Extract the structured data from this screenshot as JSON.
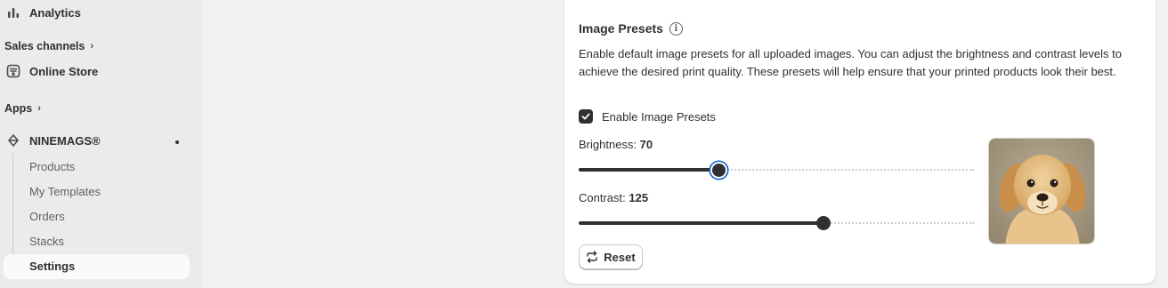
{
  "sidebar": {
    "analytics_label": "Analytics",
    "sales_channels_label": "Sales channels",
    "online_store_label": "Online Store",
    "apps_label": "Apps",
    "app_name": "NINEMAGS®",
    "sub_items": [
      "Products",
      "My Templates",
      "Orders",
      "Stacks",
      "Settings"
    ],
    "active_item": "Settings"
  },
  "presets": {
    "title": "Image Presets",
    "description": "Enable default image presets for all uploaded images. You can adjust the brightness and contrast levels to achieve the desired print quality. These presets will help ensure that your printed products look their best.",
    "checkbox_label": "Enable Image Presets",
    "checkbox_checked": true,
    "brightness_label": "Brightness:",
    "brightness_value": "70",
    "brightness_fraction": 0.355,
    "contrast_label": "Contrast:",
    "contrast_value": "125",
    "contrast_fraction": 0.62,
    "reset_label": "Reset"
  },
  "colors": {
    "accent_focus": "#005bd3",
    "dark": "#303030"
  }
}
